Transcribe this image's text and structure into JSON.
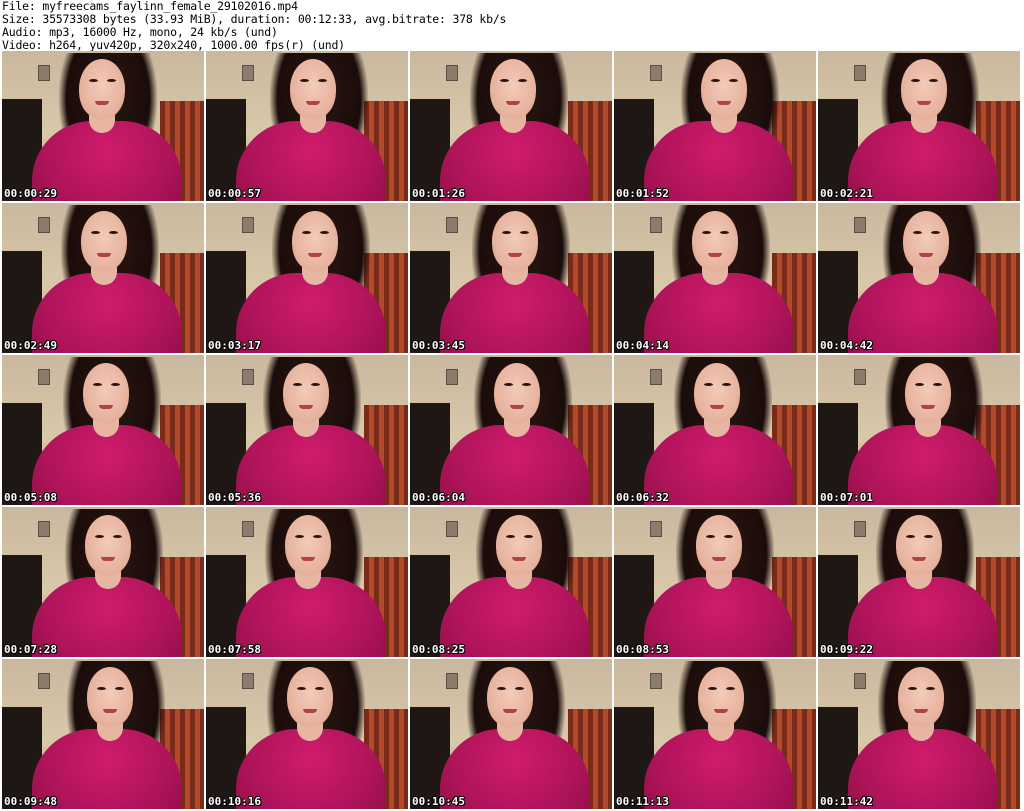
{
  "header": {
    "file_line": "File: myfreecams_faylinn_female_29102016.mp4",
    "size_line": "Size: 35573308 bytes (33.93 MiB), duration: 00:12:33, avg.bitrate: 378 kb/s",
    "audio_line": "Audio: mp3, 16000 Hz, mono, 24 kb/s (und)",
    "video_line": "Video: h264, yuv420p, 320x240, 1000.00 fps(r) (und)"
  },
  "thumbnails": [
    {
      "timestamp": "00:00:29"
    },
    {
      "timestamp": "00:00:57"
    },
    {
      "timestamp": "00:01:26"
    },
    {
      "timestamp": "00:01:52"
    },
    {
      "timestamp": "00:02:21"
    },
    {
      "timestamp": "00:02:49"
    },
    {
      "timestamp": "00:03:17"
    },
    {
      "timestamp": "00:03:45"
    },
    {
      "timestamp": "00:04:14"
    },
    {
      "timestamp": "00:04:42"
    },
    {
      "timestamp": "00:05:08"
    },
    {
      "timestamp": "00:05:36"
    },
    {
      "timestamp": "00:06:04"
    },
    {
      "timestamp": "00:06:32"
    },
    {
      "timestamp": "00:07:01"
    },
    {
      "timestamp": "00:07:28"
    },
    {
      "timestamp": "00:07:58"
    },
    {
      "timestamp": "00:08:25"
    },
    {
      "timestamp": "00:08:53"
    },
    {
      "timestamp": "00:09:22"
    },
    {
      "timestamp": "00:09:48"
    },
    {
      "timestamp": "00:10:16"
    },
    {
      "timestamp": "00:10:45"
    },
    {
      "timestamp": "00:11:13"
    },
    {
      "timestamp": "00:11:42"
    }
  ]
}
